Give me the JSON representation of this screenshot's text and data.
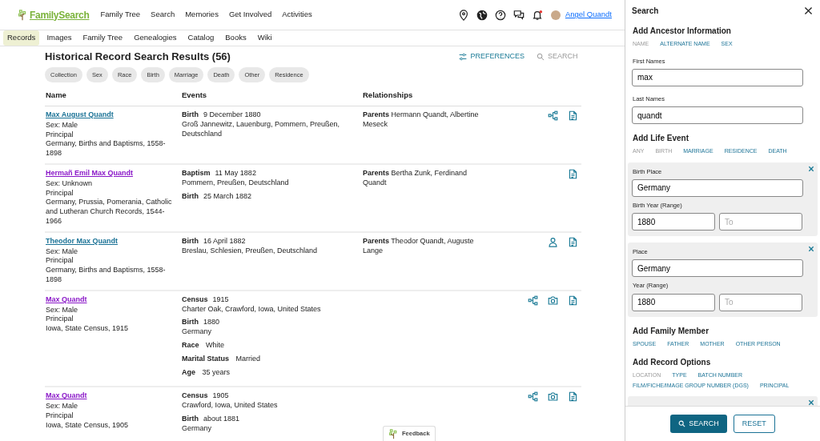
{
  "brand": {
    "name": "FamilySearch"
  },
  "top_nav": [
    "Family Tree",
    "Search",
    "Memories",
    "Get Involved",
    "Activities"
  ],
  "header_icons": [
    {
      "kind": "pin"
    },
    {
      "kind": "globe"
    },
    {
      "kind": "help"
    },
    {
      "kind": "chat"
    },
    {
      "kind": "bell",
      "badge": true
    }
  ],
  "user": {
    "name": "Angel Quandt"
  },
  "sub_nav": [
    {
      "label": "Records",
      "selected": true
    },
    {
      "label": "Images",
      "selected": false
    },
    {
      "label": "Family Tree",
      "selected": false
    },
    {
      "label": "Genealogies",
      "selected": false
    },
    {
      "label": "Catalog",
      "selected": false
    },
    {
      "label": "Books",
      "selected": false
    },
    {
      "label": "Wiki",
      "selected": false
    }
  ],
  "results": {
    "title": "Historical Record Search Results (56)",
    "preferences": "PREFERENCES",
    "search": "SEARCH",
    "filters": [
      "Collection",
      "Sex",
      "Race",
      "Birth",
      "Marriage",
      "Death",
      "Other",
      "Residence"
    ],
    "columns": [
      "Name",
      "Events",
      "Relationships"
    ],
    "rows": [
      {
        "name": "Max August Quandt",
        "visited": false,
        "details": [
          "Sex: Male",
          "Principal",
          "Germany, Births and Baptisms, 1558-1898"
        ],
        "events": [
          {
            "kind": "event",
            "label": "Birth",
            "date": "9 December 1880",
            "place": "Groß Jannewitz, Lauenburg, Pommern, Preußen, Deutschland"
          }
        ],
        "relationships": [
          {
            "label": "Parents",
            "value": "Hermann Quandt, Albertine Meseck"
          }
        ],
        "icons": [
          {
            "kind": "tree"
          },
          {
            "kind": "document"
          }
        ]
      },
      {
        "name": "Hermañ Emil Max Quandt",
        "visited": true,
        "details": [
          "Sex: Unknown",
          "Principal",
          "Germany, Prussia, Pomerania, Catholic and Lutheran Church Records, 1544-1966"
        ],
        "events": [
          {
            "kind": "event",
            "label": "Baptism",
            "date": "11 May 1882",
            "place": "Pommern, Preußen, Deutschland"
          },
          {
            "kind": "event",
            "label": "Birth",
            "date": "25 March 1882"
          }
        ],
        "relationships": [
          {
            "label": "Parents",
            "value": "Bertha Zunk, Ferdinand Quandt"
          }
        ],
        "icons": [
          {
            "kind": "document"
          }
        ]
      },
      {
        "name": "Theodor Max Quandt",
        "visited": false,
        "details": [
          "Sex: Male",
          "Principal",
          "Germany, Births and Baptisms, 1558-1898"
        ],
        "events": [
          {
            "kind": "event",
            "label": "Birth",
            "date": "16 April 1882",
            "place": "Breslau, Schlesien, Preußen, Deutschland"
          }
        ],
        "relationships": [
          {
            "label": "Parents",
            "value": "Theodor Quandt, Auguste Lange"
          }
        ],
        "icons": [
          {
            "kind": "person"
          },
          {
            "kind": "document"
          }
        ]
      },
      {
        "name": "Max Quandt",
        "visited": true,
        "details": [
          "Sex: Male",
          "Principal",
          "Iowa, State Census, 1915"
        ],
        "events": [
          {
            "kind": "event",
            "label": "Census",
            "date": "1915",
            "place": "Charter Oak, Crawford, Iowa, United States"
          },
          {
            "kind": "event",
            "label": "Birth",
            "date": "1880",
            "place": "Germany"
          },
          {
            "kind": "fact",
            "label": "Race",
            "value": "White"
          },
          {
            "kind": "fact",
            "label": "Marital Status",
            "value": "Married"
          },
          {
            "kind": "fact",
            "label": "Age",
            "value": "35 years"
          }
        ],
        "relationships": [],
        "icons": [
          {
            "kind": "tree"
          },
          {
            "kind": "camera"
          },
          {
            "kind": "document"
          }
        ]
      },
      {
        "name": "Max Quandt",
        "visited": true,
        "details": [
          "Sex: Male",
          "Principal",
          "Iowa, State Census, 1905"
        ],
        "events": [
          {
            "kind": "event",
            "label": "Census",
            "date": "1905",
            "place": "Crawford, Iowa, United States"
          },
          {
            "kind": "event",
            "label": "Birth",
            "date": "about 1881",
            "place": "Germany"
          }
        ],
        "relationships": [],
        "icons": [
          {
            "kind": "tree"
          },
          {
            "kind": "camera"
          },
          {
            "kind": "document"
          }
        ]
      }
    ]
  },
  "feedback": "Feedback",
  "search_panel": {
    "title": "Search",
    "sections": [
      {
        "kind": "options",
        "title": "Add Ancestor Information",
        "options": [
          {
            "label": "NAME",
            "disabled": true
          },
          {
            "label": "ALTERNATE NAME",
            "disabled": false
          },
          {
            "label": "SEX",
            "disabled": false
          }
        ]
      },
      {
        "kind": "fields",
        "fields": [
          {
            "label": "First Names",
            "value": "max"
          },
          {
            "label": "Last Names",
            "value": "quandt"
          }
        ]
      },
      {
        "kind": "options",
        "title": "Add Life Event",
        "options": [
          {
            "label": "ANY",
            "disabled": true
          },
          {
            "label": "BIRTH",
            "disabled": true
          },
          {
            "label": "MARRIAGE",
            "disabled": false
          },
          {
            "label": "RESIDENCE",
            "disabled": false
          },
          {
            "label": "DEATH",
            "disabled": false
          }
        ]
      },
      {
        "kind": "group",
        "place_label": "Birth Place",
        "place": "Germany",
        "year_label": "Birth Year (Range)",
        "year_from": "1880",
        "year_to_placeholder": "To"
      },
      {
        "kind": "group",
        "place_label": "Place",
        "place": "Germany",
        "year_label": "Year (Range)",
        "year_from": "1880",
        "year_to_placeholder": "To"
      },
      {
        "kind": "options",
        "title": "Add Family Member",
        "options": [
          {
            "label": "SPOUSE",
            "disabled": false
          },
          {
            "label": "FATHER",
            "disabled": false
          },
          {
            "label": "MOTHER",
            "disabled": false
          },
          {
            "label": "OTHER PERSON",
            "disabled": false
          }
        ]
      },
      {
        "kind": "options",
        "title": "Add Record Options",
        "options": [
          {
            "label": "LOCATION",
            "disabled": true
          },
          {
            "label": "TYPE",
            "disabled": false
          },
          {
            "label": "BATCH NUMBER",
            "disabled": false
          },
          {
            "label": "FILM/FICHE/IMAGE GROUP NUMBER (DGS)",
            "disabled": false
          },
          {
            "label": "PRINCIPAL",
            "disabled": false
          }
        ]
      },
      {
        "kind": "stub"
      }
    ],
    "search_button": "SEARCH",
    "reset_button": "RESET"
  }
}
